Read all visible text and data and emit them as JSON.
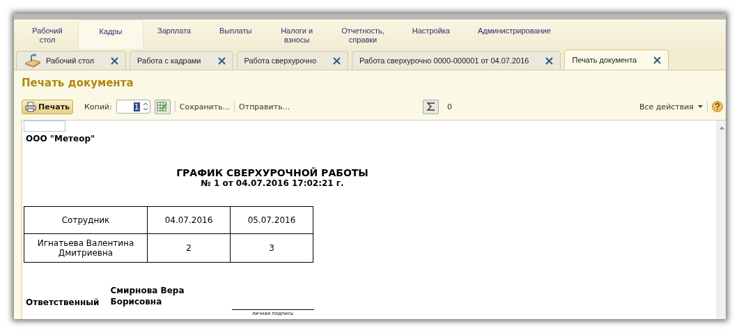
{
  "sections": [
    {
      "label": "Рабочий\nстол",
      "selected": false
    },
    {
      "label": "Кадры",
      "selected": true
    },
    {
      "label": "Зарплата",
      "selected": false
    },
    {
      "label": "Выплаты",
      "selected": false
    },
    {
      "label": "Налоги и\nвзносы",
      "selected": false
    },
    {
      "label": "Отчетность,\nсправки",
      "selected": false
    },
    {
      "label": "Настройка",
      "selected": false
    },
    {
      "label": "Администрирование",
      "selected": false
    }
  ],
  "doc_tabs": [
    {
      "label": "Рабочий стол",
      "selected": false,
      "kind": "home"
    },
    {
      "label": "Работа с кадрами",
      "selected": false,
      "kind": "plain"
    },
    {
      "label": "Работа сверхурочно",
      "selected": false,
      "kind": "plain"
    },
    {
      "label": "Работа сверхурочно 0000-000001 от 04.07.2016",
      "selected": false,
      "kind": "plain"
    },
    {
      "label": "Печать документа",
      "selected": true,
      "kind": "plain"
    }
  ],
  "page_title": "Печать документа",
  "toolbar": {
    "print": "Печать",
    "copies_label": "Копий:",
    "copies_value": "1",
    "save": "Сохранить...",
    "send": "Отправить...",
    "sum_value": "0",
    "all_actions": "Все действия"
  },
  "report": {
    "organization": "ООО \"Метеор\"",
    "title": "ГРАФИК СВЕРХУРОЧНОЙ РАБОТЫ",
    "subtitle": "№ 1 от 04.07.2016 17:02:21 г.",
    "columns": [
      "Сотрудник",
      "04.07.2016",
      "05.07.2016"
    ],
    "rows": [
      [
        "Игнатьева Валентина Дмитриевна",
        "2",
        "3"
      ]
    ],
    "responsible_label": "Ответственный",
    "responsible_name": "Смирнова Вера Борисовна",
    "signature_caption": "личная подпись"
  }
}
